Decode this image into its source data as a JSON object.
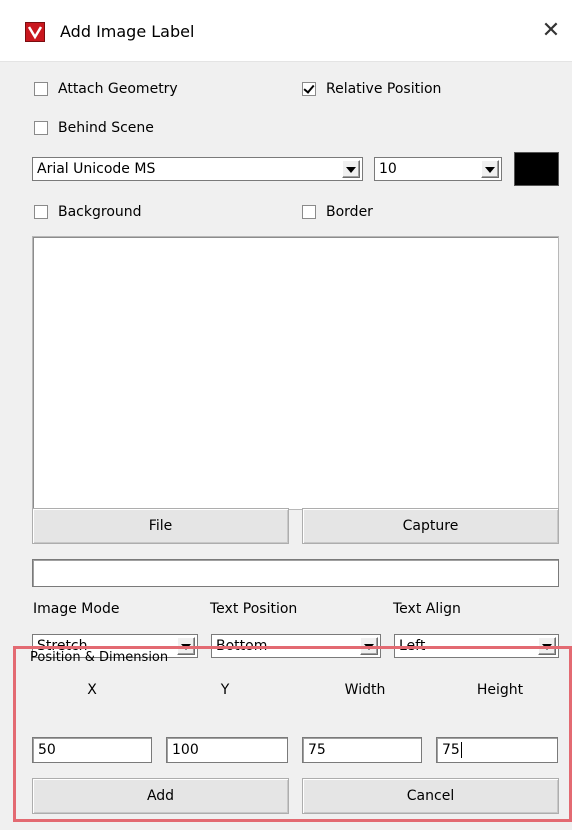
{
  "window": {
    "title": "Add Image Label",
    "icon": "app-logo-icon",
    "close_icon": "close-icon"
  },
  "checkboxes": {
    "attach_geometry": {
      "label": "Attach Geometry",
      "checked": false
    },
    "relative_position": {
      "label": "Relative Position",
      "checked": true
    },
    "behind_scene": {
      "label": "Behind Scene",
      "checked": false
    },
    "background": {
      "label": "Background",
      "checked": false
    },
    "border": {
      "label": "Border",
      "checked": false
    }
  },
  "font": {
    "family": "Arial Unicode MS",
    "size": "10",
    "color": "#000000"
  },
  "buttons": {
    "file": "File",
    "capture": "Capture",
    "add": "Add",
    "cancel": "Cancel"
  },
  "path_value": "",
  "image_options": {
    "image_mode_label": "Image Mode",
    "image_mode_value": "Stretch",
    "text_position_label": "Text Position",
    "text_position_value": "Bottom",
    "text_align_label": "Text Align",
    "text_align_value": "Left"
  },
  "position_dimension": {
    "title": "Position & Dimension",
    "x_label": "X",
    "y_label": "Y",
    "width_label": "Width",
    "height_label": "Height",
    "x_value": "50",
    "y_value": "100",
    "width_value": "75",
    "height_value": "75"
  },
  "highlight_color": "#e36a72"
}
